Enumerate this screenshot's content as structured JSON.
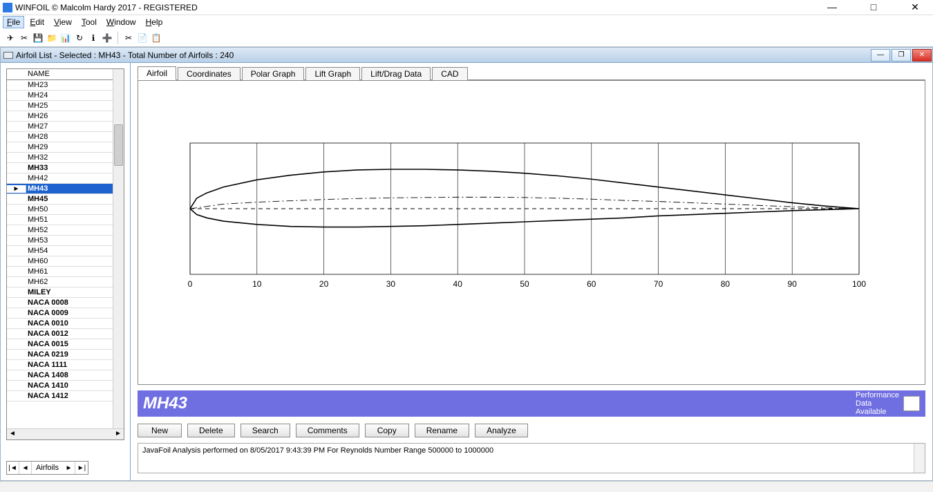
{
  "app": {
    "title": "WINFOIL © Malcolm Hardy 2017 - REGISTERED"
  },
  "menu": {
    "items": [
      "File",
      "Edit",
      "View",
      "Tool",
      "Window",
      "Help"
    ],
    "open_index": 0
  },
  "child_window": {
    "title": "Airfoil List - Selected : MH43 - Total Number of Airfoils : 240"
  },
  "sidebar": {
    "header": "NAME",
    "items": [
      {
        "name": "MH23",
        "bold": false
      },
      {
        "name": "MH24",
        "bold": false
      },
      {
        "name": "MH25",
        "bold": false
      },
      {
        "name": "MH26",
        "bold": false
      },
      {
        "name": "MH27",
        "bold": false
      },
      {
        "name": "MH28",
        "bold": false
      },
      {
        "name": "MH29",
        "bold": false
      },
      {
        "name": "MH32",
        "bold": false
      },
      {
        "name": "MH33",
        "bold": true
      },
      {
        "name": "MH42",
        "bold": false
      },
      {
        "name": "MH43",
        "bold": true,
        "selected": true
      },
      {
        "name": "MH45",
        "bold": true
      },
      {
        "name": "MH50",
        "bold": false
      },
      {
        "name": "MH51",
        "bold": false
      },
      {
        "name": "MH52",
        "bold": false
      },
      {
        "name": "MH53",
        "bold": false
      },
      {
        "name": "MH54",
        "bold": false
      },
      {
        "name": "MH60",
        "bold": false
      },
      {
        "name": "MH61",
        "bold": false
      },
      {
        "name": "MH62",
        "bold": false
      },
      {
        "name": "MILEY",
        "bold": true
      },
      {
        "name": "NACA 0008",
        "bold": true
      },
      {
        "name": "NACA 0009",
        "bold": true
      },
      {
        "name": "NACA 0010",
        "bold": true
      },
      {
        "name": "NACA 0012",
        "bold": true
      },
      {
        "name": "NACA 0015",
        "bold": true
      },
      {
        "name": "NACA 0219",
        "bold": true
      },
      {
        "name": "NACA 1111",
        "bold": true
      },
      {
        "name": "NACA 1408",
        "bold": true
      },
      {
        "name": "NACA 1410",
        "bold": true
      },
      {
        "name": "NACA 1412",
        "bold": true
      }
    ],
    "nav_label": "Airfoils"
  },
  "tabs": {
    "items": [
      "Airfoil",
      "Coordinates",
      "Polar Graph",
      "Lift Graph",
      "Lift/Drag Data",
      "CAD"
    ],
    "active_index": 0
  },
  "airfoil_strip": {
    "name": "MH43",
    "perf_line1": "Performance",
    "perf_line2": "Data",
    "perf_line3": "Available"
  },
  "buttons": {
    "new": "New",
    "delete": "Delete",
    "search": "Search",
    "comments": "Comments",
    "copy": "Copy",
    "rename": "Rename",
    "analyze": "Analyze"
  },
  "status": {
    "text": "JavaFoil Analysis performed on 8/05/2017 9:43:39 PM  For Reynolds Number Range 500000 to 1000000"
  },
  "chart_data": {
    "type": "line",
    "title": "",
    "xlabel": "",
    "ylabel": "",
    "xlim": [
      0,
      100
    ],
    "xticks": [
      0,
      10,
      20,
      30,
      40,
      50,
      60,
      70,
      80,
      90,
      100
    ],
    "series": [
      {
        "name": "upper",
        "style": "solid",
        "x": [
          0,
          1,
          2.5,
          5,
          10,
          15,
          20,
          25,
          30,
          35,
          40,
          45,
          50,
          55,
          60,
          65,
          70,
          75,
          80,
          85,
          90,
          95,
          100
        ],
        "y": [
          0,
          1.6,
          2.4,
          3.3,
          4.4,
          5.1,
          5.6,
          5.9,
          6.0,
          6.0,
          5.9,
          5.7,
          5.4,
          5.0,
          4.5,
          3.9,
          3.3,
          2.7,
          2.1,
          1.5,
          0.9,
          0.4,
          0
        ]
      },
      {
        "name": "lower",
        "style": "solid",
        "x": [
          0,
          1,
          2.5,
          5,
          10,
          15,
          20,
          25,
          30,
          35,
          40,
          45,
          50,
          55,
          60,
          65,
          70,
          75,
          80,
          85,
          90,
          95,
          100
        ],
        "y": [
          0,
          -0.9,
          -1.4,
          -1.9,
          -2.4,
          -2.7,
          -2.8,
          -2.8,
          -2.7,
          -2.6,
          -2.4,
          -2.2,
          -2.0,
          -1.8,
          -1.6,
          -1.4,
          -1.1,
          -0.9,
          -0.7,
          -0.5,
          -0.3,
          -0.15,
          0
        ]
      },
      {
        "name": "camber",
        "style": "dashdot",
        "x": [
          0,
          5,
          10,
          15,
          20,
          25,
          30,
          35,
          40,
          45,
          50,
          55,
          60,
          65,
          70,
          75,
          80,
          85,
          90,
          95,
          100
        ],
        "y": [
          0,
          0.7,
          1.0,
          1.2,
          1.4,
          1.55,
          1.65,
          1.7,
          1.75,
          1.75,
          1.7,
          1.6,
          1.45,
          1.25,
          1.1,
          0.9,
          0.7,
          0.5,
          0.3,
          0.12,
          0
        ]
      },
      {
        "name": "chord",
        "style": "dash",
        "x": [
          0,
          100
        ],
        "y": [
          0,
          0
        ]
      }
    ],
    "ylim": [
      -10,
      10
    ]
  }
}
